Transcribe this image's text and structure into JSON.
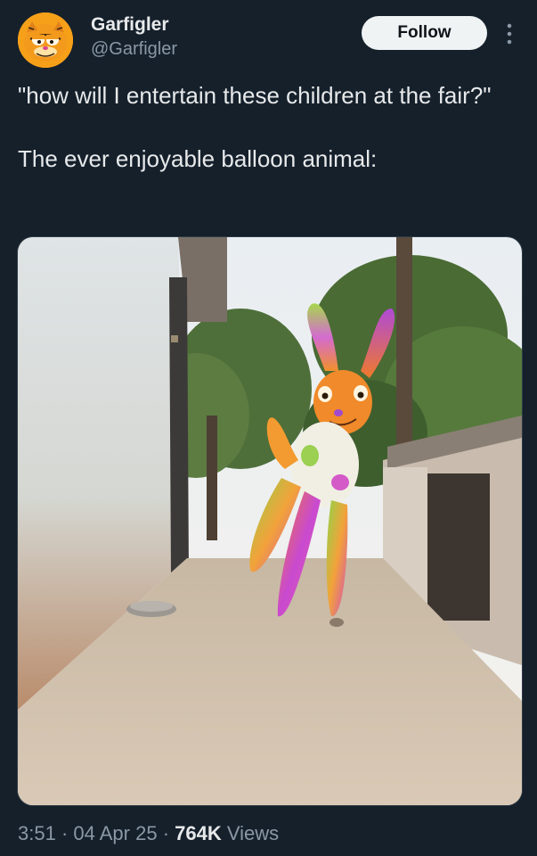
{
  "author": {
    "display_name": "Garfigler",
    "handle": "@Garfigler",
    "avatar_icon": "garfield-avatar-icon"
  },
  "actions": {
    "follow_label": "Follow",
    "more_icon": "more-vertical-icon"
  },
  "tweet": {
    "line1": "\"how will I entertain these children at the fair?\"",
    "line2": "The ever enjoyable balloon animal:"
  },
  "media": {
    "description_icon": "photo-balloon-animal"
  },
  "meta": {
    "time": "3:51",
    "sep1": " · ",
    "date": "04 Apr 25",
    "sep2": " · ",
    "views_count": "764K",
    "views_label": " Views"
  },
  "colors": {
    "background": "#15202b",
    "text": "#e7e9ea",
    "secondary_text": "#8b98a5",
    "follow_bg": "#eff3f4"
  }
}
